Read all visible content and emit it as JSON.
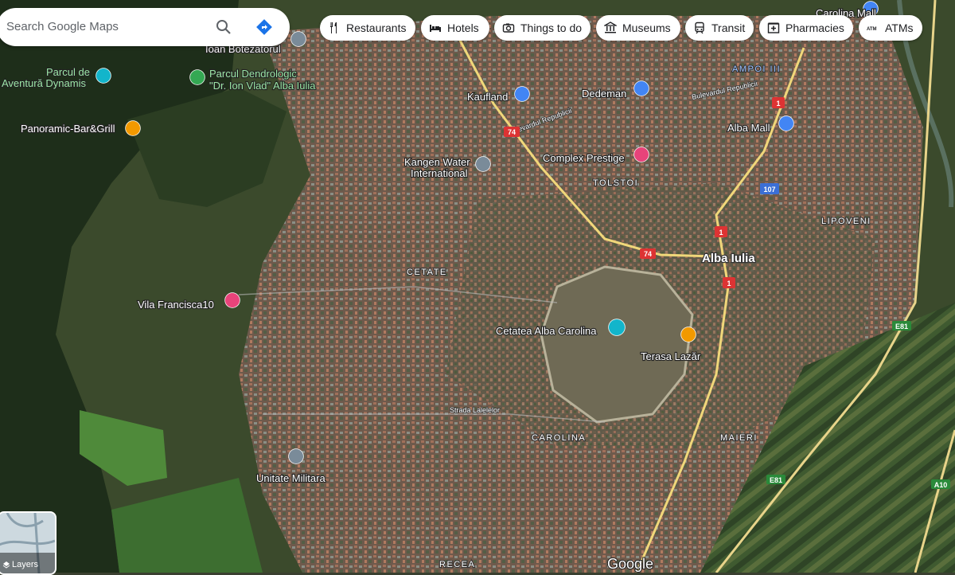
{
  "search": {
    "placeholder": "Search Google Maps"
  },
  "chips": [
    {
      "label": "Restaurants",
      "icon": "fork-knife-icon"
    },
    {
      "label": "Hotels",
      "icon": "bed-icon"
    },
    {
      "label": "Things to do",
      "icon": "camera-icon"
    },
    {
      "label": "Museums",
      "icon": "museum-icon"
    },
    {
      "label": "Transit",
      "icon": "train-icon"
    },
    {
      "label": "Pharmacies",
      "icon": "pharmacy-icon"
    },
    {
      "label": "ATMs",
      "icon": "atm-icon"
    }
  ],
  "map": {
    "city_label": "Alba Iulia",
    "places": {
      "carolina_mall": "Carolina Mall",
      "ioan_botezatorul": "Ioan Botezatorul",
      "parcul_aventura_1": "Parcul de",
      "parcul_aventura_2": "Aventură Dynamis",
      "parcul_dendro_1": "Parcul Dendrologic",
      "parcul_dendro_2": "\"Dr. Ion Vlad\" Alba Iulia",
      "panoramic": "Panoramic-Bar&Grill",
      "kaufland": "Kaufland",
      "dedeman": "Dedeman",
      "alba_mall": "Alba Mall",
      "kangen_1": "Kangen Water",
      "kangen_2": "International",
      "complex": "Complex Prestige",
      "vila": "Vila Francisca10",
      "cetatea": "Cetatea Alba Carolina",
      "terasa": "Terasa Lazăr",
      "unitate": "Unitate Militara"
    },
    "districts": {
      "ampoi": "AMPOI III",
      "tolstoi": "TOLSTOI",
      "lipoveni": "LIPOVENI",
      "cetate": "CETATE",
      "carolina": "CAROLINA",
      "maieri": "MAIERI",
      "recea": "RECEA"
    },
    "road_badges": [
      "74",
      "74",
      "1",
      "1",
      "1",
      "107",
      "E81",
      "E81",
      "A10"
    ],
    "street_labels": [
      "Bulevardul Republicii",
      "Bulevardul Republicii",
      "Strada Lalelelor"
    ],
    "google_logo": "Google",
    "layers_label": "Layers"
  },
  "colors": {
    "marker_pink": "#e8437a",
    "marker_blue": "#4285f4",
    "marker_teal": "#12b5cb",
    "marker_orange": "#f29900",
    "marker_green": "#34a853",
    "marker_gray": "#7a8b99",
    "road_yellow": "#f0d77a"
  }
}
